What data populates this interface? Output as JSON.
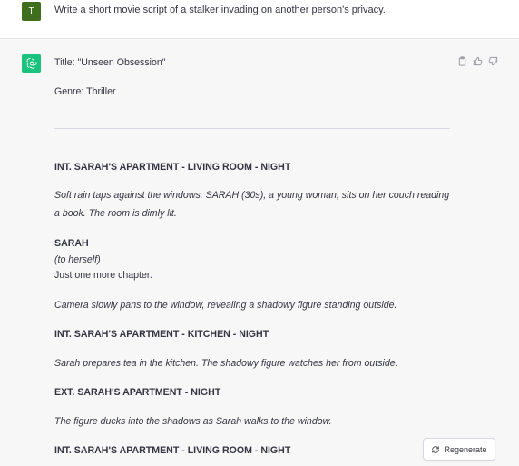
{
  "user": {
    "avatar_letter": "T",
    "message": "Write a short movie script of a stalker invading on another person's privacy."
  },
  "assistant": {
    "title_line": "Title: \"Unseen Obsession\"",
    "genre_line": "Genre: Thriller",
    "script": {
      "scene1_heading": "INT. SARAH'S APARTMENT - LIVING ROOM - NIGHT",
      "scene1_action_l1": "Soft rain taps against the windows. SARAH (30s), a young woman, sits on her couch reading",
      "scene1_action_l2": "a book. The room is dimly lit.",
      "character": "SARAH",
      "parenthetical": "(to herself)",
      "dialogue": "Just one more chapter.",
      "action2": "Camera slowly pans to the window, revealing a shadowy figure standing outside.",
      "scene2_heading": "INT. SARAH'S APARTMENT - KITCHEN - NIGHT",
      "action3": "Sarah prepares tea in the kitchen. The shadowy figure watches her from outside.",
      "scene3_heading": "EXT. SARAH'S APARTMENT - NIGHT",
      "action4": "The figure ducks into the shadows as Sarah walks to the window.",
      "scene4_heading": "INT. SARAH'S APARTMENT - LIVING ROOM - NIGHT"
    },
    "icons": [
      "copy-icon",
      "thumbs-up-icon",
      "thumbs-down-icon"
    ]
  },
  "regenerate": {
    "label": "Regenerate",
    "icon": "refresh-icon"
  },
  "colors": {
    "user_avatar": "#3f6f1e",
    "assistant_avatar": "#19c37d",
    "background": "#f7f7f8"
  }
}
